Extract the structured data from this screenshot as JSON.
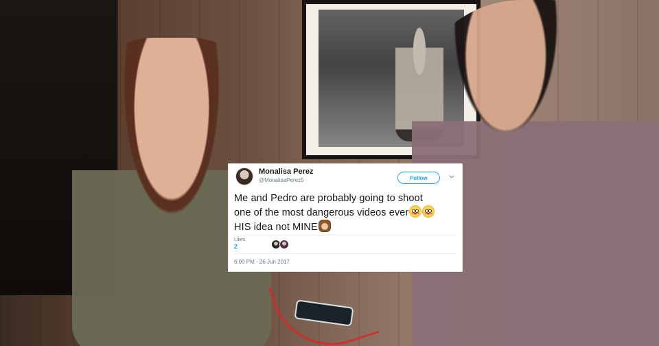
{
  "tweet": {
    "display_name": "Monalisa Perez",
    "handle": "@MonalisaPerez5",
    "follow_label": "Follow",
    "text_lines": [
      "Me and Pedro are probably going to shoot",
      "one of the most dangerous videos ever",
      "HIS idea not MINE"
    ],
    "emojis": {
      "line2": [
        "flushed-face-emoji",
        "flushed-face-emoji"
      ],
      "line3": [
        "speak-no-evil-monkey-emoji"
      ]
    },
    "likes_label": "Likes",
    "likes_count": "2",
    "timestamp": "6:00 PM - 26 Jun 2017",
    "colors": {
      "accent": "#1da1f2",
      "text": "#14171a",
      "muted": "#657786",
      "border": "#e6ecf0"
    }
  }
}
